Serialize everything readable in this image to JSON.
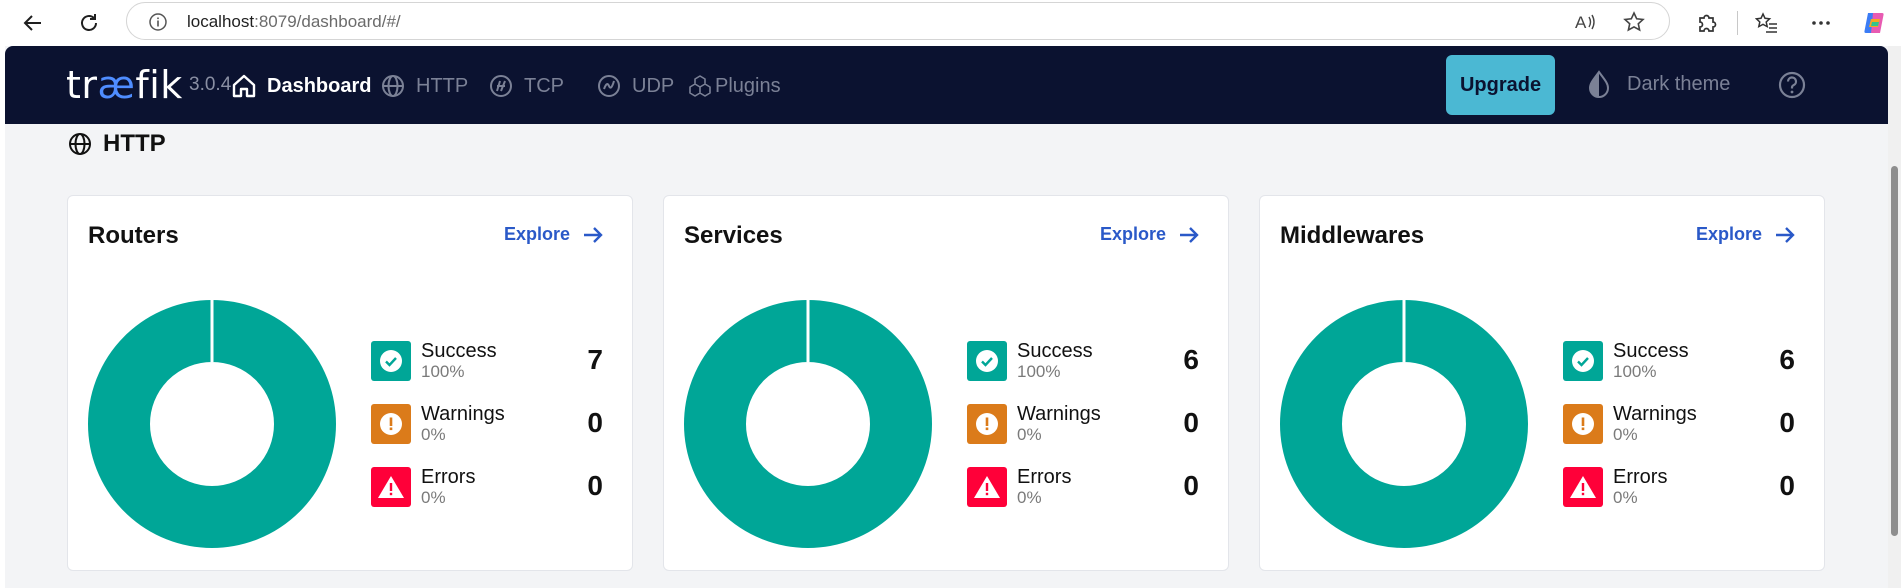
{
  "browser": {
    "url_host": "localhost",
    "url_rest": ":8079/dashboard/#/"
  },
  "navbar": {
    "brand_pre": "tr",
    "brand_ae": "æ",
    "brand_post": "fik",
    "version": "3.0.4",
    "items": [
      {
        "label": "Dashboard",
        "icon": "home-icon",
        "active": true
      },
      {
        "label": "HTTP",
        "icon": "globe-icon",
        "active": false
      },
      {
        "label": "TCP",
        "icon": "tcp-icon",
        "active": false
      },
      {
        "label": "UDP",
        "icon": "udp-icon",
        "active": false
      },
      {
        "label": "Plugins",
        "icon": "plugins-icon",
        "active": false
      }
    ],
    "upgrade_label": "Upgrade",
    "dark_theme_label": "Dark theme"
  },
  "section": {
    "title": "HTTP"
  },
  "cards": [
    {
      "title": "Routers",
      "explore_label": "Explore",
      "stats": [
        {
          "label": "Success",
          "pct": "100%",
          "count": "7"
        },
        {
          "label": "Warnings",
          "pct": "0%",
          "count": "0"
        },
        {
          "label": "Errors",
          "pct": "0%",
          "count": "0"
        }
      ]
    },
    {
      "title": "Services",
      "explore_label": "Explore",
      "stats": [
        {
          "label": "Success",
          "pct": "100%",
          "count": "6"
        },
        {
          "label": "Warnings",
          "pct": "0%",
          "count": "0"
        },
        {
          "label": "Errors",
          "pct": "0%",
          "count": "0"
        }
      ]
    },
    {
      "title": "Middlewares",
      "explore_label": "Explore",
      "stats": [
        {
          "label": "Success",
          "pct": "100%",
          "count": "6"
        },
        {
          "label": "Warnings",
          "pct": "0%",
          "count": "0"
        },
        {
          "label": "Errors",
          "pct": "0%",
          "count": "0"
        }
      ]
    }
  ],
  "colors": {
    "success": "#00a697",
    "warning": "#db7b1a",
    "error": "#ff0039",
    "navbar": "#0b1230",
    "accent": "#4bb8d3",
    "link": "#2a59c8"
  }
}
